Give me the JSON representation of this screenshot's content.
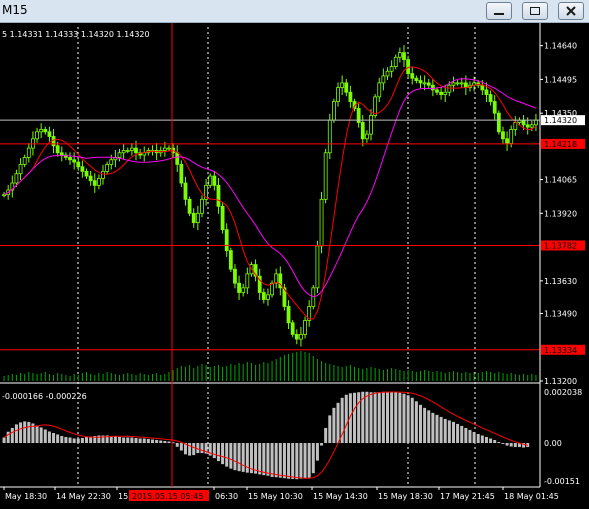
{
  "window": {
    "title": "M15",
    "buttons": [
      "minimize",
      "restore",
      "close"
    ]
  },
  "price_info": "5 1.14331 1.14333 1.14320 1.14320",
  "indicator_info": "-0.000166 -0.000226",
  "colors": {
    "background": "#000000",
    "candles": "#7cfc00",
    "ma_fast": "#ff0000",
    "ma_slow": "#ff00ff",
    "volume": "#00aa00",
    "histogram": "#c0c0c0",
    "signal": "#ff0000",
    "grid": "#ffffff",
    "level_line": "#ff0000",
    "bid_line": "#c0c0c0",
    "crosshair": "#ff0000",
    "axis_text": "#ffffff",
    "level_label_bg": "#ff0000"
  },
  "price_axis": {
    "labels": [
      "1.14640",
      "1.14495",
      "1.14350",
      "1.14065",
      "1.13920",
      "1.13630",
      "1.13490",
      "1.13200"
    ],
    "current_price": "1.14320",
    "levels": [
      "1.14218",
      "1.13782",
      "1.13334"
    ]
  },
  "indicator_axis": {
    "labels": [
      "0.002038",
      "0.00",
      "-0.00151"
    ]
  },
  "time_axis": {
    "labels": [
      "May 18:30",
      "14 May 22:30",
      "15",
      "06:30",
      "15 May 10:30",
      "15 May 14:30",
      "15 May 18:30",
      "17 May 21:45",
      "18 May 01:45"
    ],
    "cursor_label": "2015.05.15 05:45"
  },
  "chart_data": {
    "type": "candlestick",
    "symbol_timeframe": "M15",
    "ylim": [
      1.132,
      1.1472
    ],
    "close": [
      1.14,
      1.1402,
      1.1405,
      1.1409,
      1.1413,
      1.1416,
      1.142,
      1.1424,
      1.1427,
      1.1428,
      1.1427,
      1.1425,
      1.1421,
      1.1418,
      1.1417,
      1.1416,
      1.1415,
      1.1414,
      1.1412,
      1.141,
      1.1408,
      1.1406,
      1.1404,
      1.1407,
      1.141,
      1.1413,
      1.1415,
      1.1416,
      1.1418,
      1.1419,
      1.1419,
      1.142,
      1.1418,
      1.1417,
      1.1418,
      1.1419,
      1.1419,
      1.1418,
      1.1419,
      1.142,
      1.142,
      1.1418,
      1.1413,
      1.1405,
      1.1398,
      1.1392,
      1.1388,
      1.1392,
      1.1398,
      1.1404,
      1.1408,
      1.1404,
      1.1395,
      1.1385,
      1.1376,
      1.1368,
      1.1362,
      1.1358,
      1.136,
      1.1366,
      1.137,
      1.1365,
      1.1358,
      1.1355,
      1.1357,
      1.1362,
      1.1366,
      1.136,
      1.1352,
      1.1345,
      1.134,
      1.1338,
      1.134,
      1.1346,
      1.1352,
      1.136,
      1.1378,
      1.1398,
      1.1418,
      1.1432,
      1.144,
      1.1446,
      1.1448,
      1.1444,
      1.144,
      1.1437,
      1.1431,
      1.1424,
      1.1426,
      1.1434,
      1.1442,
      1.1448,
      1.1451,
      1.1453,
      1.1455,
      1.1459,
      1.1461,
      1.1458,
      1.1452,
      1.145,
      1.1449,
      1.1448,
      1.1448,
      1.1447,
      1.1445,
      1.1444,
      1.1443,
      1.1444,
      1.1447,
      1.1448,
      1.1448,
      1.1448,
      1.1446,
      1.1447,
      1.1448,
      1.1447,
      1.1445,
      1.1443,
      1.144,
      1.1435,
      1.1427,
      1.1424,
      1.1422,
      1.1428,
      1.1431,
      1.1432,
      1.143,
      1.1429,
      1.143,
      1.1432
    ],
    "volume": [
      5,
      6,
      7,
      6,
      8,
      7,
      9,
      8,
      7,
      8,
      9,
      7,
      6,
      8,
      7,
      6,
      5,
      7,
      6,
      8,
      9,
      7,
      6,
      8,
      7,
      9,
      8,
      7,
      6,
      7,
      8,
      7,
      6,
      8,
      7,
      6,
      7,
      8,
      6,
      7,
      9,
      11,
      13,
      15,
      14,
      16,
      13,
      15,
      17,
      16,
      14,
      15,
      16,
      14,
      15,
      17,
      16,
      18,
      17,
      19,
      18,
      16,
      17,
      19,
      18,
      20,
      22,
      24,
      26,
      27,
      28,
      29,
      30,
      29,
      28,
      25,
      22,
      20,
      18,
      17,
      16,
      15,
      14,
      15,
      16,
      14,
      13,
      12,
      13,
      14,
      13,
      12,
      11,
      12,
      13,
      12,
      11,
      10,
      11,
      10,
      9,
      10,
      11,
      10,
      9,
      10,
      9,
      8,
      9,
      10,
      9,
      8,
      9,
      8,
      9,
      8,
      9,
      10,
      9,
      8,
      9,
      8,
      7,
      8,
      7,
      6,
      7,
      6,
      7,
      6
    ],
    "histogram": [
      0.00022,
      0.00045,
      0.0006,
      0.00074,
      0.00082,
      0.00086,
      0.00084,
      0.00078,
      0.0007,
      0.00062,
      0.00054,
      0.00046,
      0.0004,
      0.00034,
      0.00028,
      0.00024,
      0.00022,
      0.00018,
      0.00018,
      0.0002,
      0.00024,
      0.00026,
      0.00028,
      0.0003,
      0.0003,
      0.0003,
      0.00028,
      0.00026,
      0.00024,
      0.00022,
      0.00022,
      0.00022,
      0.0002,
      0.00018,
      0.00018,
      0.00016,
      0.00014,
      0.00012,
      0.0001,
      8e-05,
      6e-05,
      3e-05,
      -0.00015,
      -0.0003,
      -0.00045,
      -0.0005,
      -0.00048,
      -0.0004,
      -0.0004,
      -0.00042,
      -0.0005,
      -0.0006,
      -0.00072,
      -0.00084,
      -0.00094,
      -0.00102,
      -0.00108,
      -0.00112,
      -0.00115,
      -0.00118,
      -0.0012,
      -0.00122,
      -0.00125,
      -0.00128,
      -0.0013,
      -0.00135,
      -0.00136,
      -0.00138,
      -0.0014,
      -0.00142,
      -0.00143,
      -0.00144,
      -0.00142,
      -0.0014,
      -0.00138,
      -0.0012,
      -0.0007,
      -0.0001,
      0.0006,
      0.0011,
      0.0014,
      0.0016,
      0.0018,
      0.00192,
      0.00198,
      0.002,
      0.00202,
      0.00204,
      0.00204,
      0.00202,
      0.00202,
      0.00203,
      0.00204,
      0.00204,
      0.00203,
      0.00202,
      0.002,
      0.00196,
      0.0019,
      0.0018,
      0.00166,
      0.00152,
      0.0014,
      0.0013,
      0.0012,
      0.00112,
      0.00104,
      0.00096,
      0.0009,
      0.00084,
      0.00076,
      0.00068,
      0.0006,
      0.00052,
      0.00044,
      0.00036,
      0.0003,
      0.00024,
      0.00018,
      0.00012,
      4e-05,
      -4e-05,
      -0.0001,
      -0.00014,
      -0.00016,
      -0.00016,
      -0.00018,
      -0.00016
    ],
    "indicator_ylim": [
      -0.00175,
      0.00215
    ]
  }
}
